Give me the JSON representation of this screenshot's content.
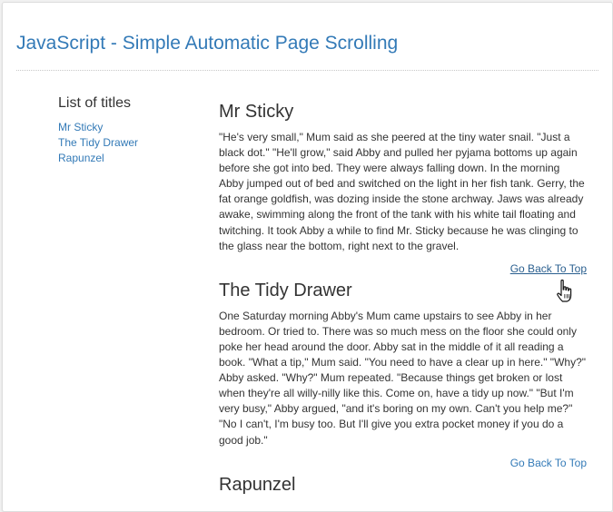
{
  "header": {
    "title": "JavaScript - Simple Automatic Page Scrolling"
  },
  "sidebar": {
    "heading": "List of titles",
    "items": [
      {
        "label": "Mr Sticky"
      },
      {
        "label": "The Tidy Drawer"
      },
      {
        "label": "Rapunzel"
      }
    ]
  },
  "stories": [
    {
      "title": "Mr Sticky",
      "text": "\"He's very small,\" Mum said as she peered at the tiny water snail. \"Just a black dot.\" \"He'll grow,\" said Abby and pulled her pyjama bottoms up again before she got into bed. They were always falling down. In the morning Abby jumped out of bed and switched on the light in her fish tank. Gerry, the fat orange goldfish, was dozing inside the stone archway. Jaws was already awake, swimming along the front of the tank with his white tail floating and twitching. It took Abby a while to find Mr. Sticky because he was clinging to the glass near the bottom, right next to the gravel.",
      "back_link": "Go Back To Top"
    },
    {
      "title": "The Tidy Drawer",
      "text": "One Saturday morning Abby's Mum came upstairs to see Abby in her bedroom. Or tried to. There was so much mess on the floor she could only poke her head around the door. Abby sat in the middle of it all reading a book. \"What a tip,\" Mum said. \"You need to have a clear up in here.\" \"Why?\" Abby asked. \"Why?\" Mum repeated. \"Because things get broken or lost when they're all willy-nilly like this. Come on, have a tidy up now.\" \"But I'm very busy,\" Abby argued, \"and it's boring on my own. Can't you help me?\" \"No I can't, I'm busy too. But I'll give you extra pocket money if you do a good job.\"",
      "back_link": "Go Back To Top"
    },
    {
      "title": "Rapunzel"
    }
  ],
  "colors": {
    "link": "#337ab7",
    "text": "#333333",
    "background": "#f1f1f1"
  },
  "icons": {
    "cursor": "hand-pointer-icon"
  }
}
